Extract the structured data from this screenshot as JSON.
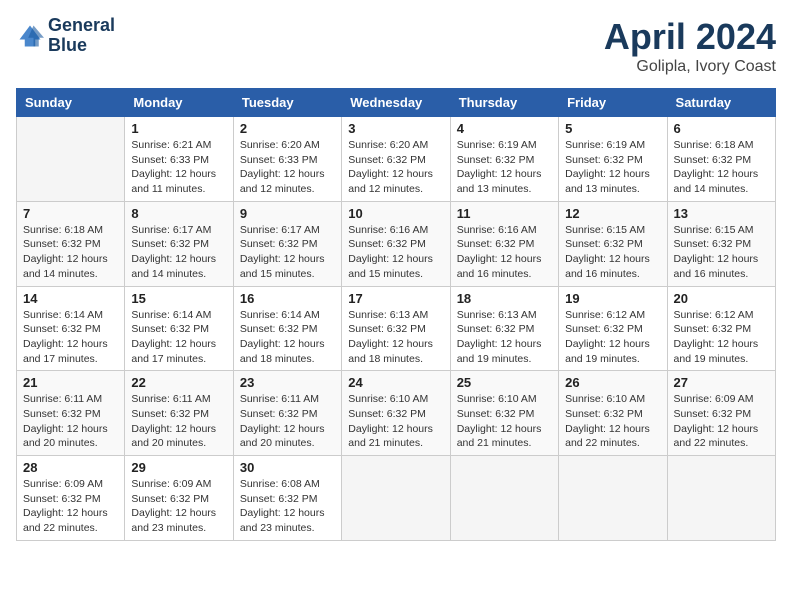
{
  "header": {
    "logo_line1": "General",
    "logo_line2": "Blue",
    "month": "April 2024",
    "location": "Golipla, Ivory Coast"
  },
  "weekdays": [
    "Sunday",
    "Monday",
    "Tuesday",
    "Wednesday",
    "Thursday",
    "Friday",
    "Saturday"
  ],
  "weeks": [
    [
      {
        "num": "",
        "info": ""
      },
      {
        "num": "1",
        "info": "Sunrise: 6:21 AM\nSunset: 6:33 PM\nDaylight: 12 hours\nand 11 minutes."
      },
      {
        "num": "2",
        "info": "Sunrise: 6:20 AM\nSunset: 6:33 PM\nDaylight: 12 hours\nand 12 minutes."
      },
      {
        "num": "3",
        "info": "Sunrise: 6:20 AM\nSunset: 6:32 PM\nDaylight: 12 hours\nand 12 minutes."
      },
      {
        "num": "4",
        "info": "Sunrise: 6:19 AM\nSunset: 6:32 PM\nDaylight: 12 hours\nand 13 minutes."
      },
      {
        "num": "5",
        "info": "Sunrise: 6:19 AM\nSunset: 6:32 PM\nDaylight: 12 hours\nand 13 minutes."
      },
      {
        "num": "6",
        "info": "Sunrise: 6:18 AM\nSunset: 6:32 PM\nDaylight: 12 hours\nand 14 minutes."
      }
    ],
    [
      {
        "num": "7",
        "info": "Sunrise: 6:18 AM\nSunset: 6:32 PM\nDaylight: 12 hours\nand 14 minutes."
      },
      {
        "num": "8",
        "info": "Sunrise: 6:17 AM\nSunset: 6:32 PM\nDaylight: 12 hours\nand 14 minutes."
      },
      {
        "num": "9",
        "info": "Sunrise: 6:17 AM\nSunset: 6:32 PM\nDaylight: 12 hours\nand 15 minutes."
      },
      {
        "num": "10",
        "info": "Sunrise: 6:16 AM\nSunset: 6:32 PM\nDaylight: 12 hours\nand 15 minutes."
      },
      {
        "num": "11",
        "info": "Sunrise: 6:16 AM\nSunset: 6:32 PM\nDaylight: 12 hours\nand 16 minutes."
      },
      {
        "num": "12",
        "info": "Sunrise: 6:15 AM\nSunset: 6:32 PM\nDaylight: 12 hours\nand 16 minutes."
      },
      {
        "num": "13",
        "info": "Sunrise: 6:15 AM\nSunset: 6:32 PM\nDaylight: 12 hours\nand 16 minutes."
      }
    ],
    [
      {
        "num": "14",
        "info": "Sunrise: 6:14 AM\nSunset: 6:32 PM\nDaylight: 12 hours\nand 17 minutes."
      },
      {
        "num": "15",
        "info": "Sunrise: 6:14 AM\nSunset: 6:32 PM\nDaylight: 12 hours\nand 17 minutes."
      },
      {
        "num": "16",
        "info": "Sunrise: 6:14 AM\nSunset: 6:32 PM\nDaylight: 12 hours\nand 18 minutes."
      },
      {
        "num": "17",
        "info": "Sunrise: 6:13 AM\nSunset: 6:32 PM\nDaylight: 12 hours\nand 18 minutes."
      },
      {
        "num": "18",
        "info": "Sunrise: 6:13 AM\nSunset: 6:32 PM\nDaylight: 12 hours\nand 19 minutes."
      },
      {
        "num": "19",
        "info": "Sunrise: 6:12 AM\nSunset: 6:32 PM\nDaylight: 12 hours\nand 19 minutes."
      },
      {
        "num": "20",
        "info": "Sunrise: 6:12 AM\nSunset: 6:32 PM\nDaylight: 12 hours\nand 19 minutes."
      }
    ],
    [
      {
        "num": "21",
        "info": "Sunrise: 6:11 AM\nSunset: 6:32 PM\nDaylight: 12 hours\nand 20 minutes."
      },
      {
        "num": "22",
        "info": "Sunrise: 6:11 AM\nSunset: 6:32 PM\nDaylight: 12 hours\nand 20 minutes."
      },
      {
        "num": "23",
        "info": "Sunrise: 6:11 AM\nSunset: 6:32 PM\nDaylight: 12 hours\nand 20 minutes."
      },
      {
        "num": "24",
        "info": "Sunrise: 6:10 AM\nSunset: 6:32 PM\nDaylight: 12 hours\nand 21 minutes."
      },
      {
        "num": "25",
        "info": "Sunrise: 6:10 AM\nSunset: 6:32 PM\nDaylight: 12 hours\nand 21 minutes."
      },
      {
        "num": "26",
        "info": "Sunrise: 6:10 AM\nSunset: 6:32 PM\nDaylight: 12 hours\nand 22 minutes."
      },
      {
        "num": "27",
        "info": "Sunrise: 6:09 AM\nSunset: 6:32 PM\nDaylight: 12 hours\nand 22 minutes."
      }
    ],
    [
      {
        "num": "28",
        "info": "Sunrise: 6:09 AM\nSunset: 6:32 PM\nDaylight: 12 hours\nand 22 minutes."
      },
      {
        "num": "29",
        "info": "Sunrise: 6:09 AM\nSunset: 6:32 PM\nDaylight: 12 hours\nand 23 minutes."
      },
      {
        "num": "30",
        "info": "Sunrise: 6:08 AM\nSunset: 6:32 PM\nDaylight: 12 hours\nand 23 minutes."
      },
      {
        "num": "",
        "info": ""
      },
      {
        "num": "",
        "info": ""
      },
      {
        "num": "",
        "info": ""
      },
      {
        "num": "",
        "info": ""
      }
    ]
  ]
}
